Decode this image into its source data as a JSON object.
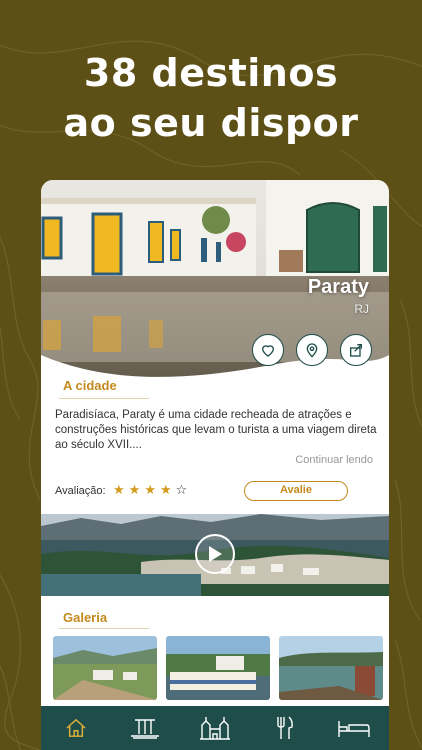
{
  "headline": {
    "line1": "38 destinos",
    "line2": "ao seu dispor"
  },
  "hero": {
    "city": "Paraty",
    "state": "RJ"
  },
  "actions": [
    "heart-icon",
    "location-pin-icon",
    "share-icon"
  ],
  "about": {
    "title": "A cidade",
    "description": "Paradisíaca, Paraty é uma cidade recheada de atrações e construções históricas que levam o turista a uma viagem direta ao século XVII....",
    "read_more": "Continuar lendo"
  },
  "rating": {
    "label": "Avaliação:",
    "stars": 4,
    "max": 5,
    "rate_button": "Avalie"
  },
  "gallery": {
    "title": "Galeria"
  },
  "tabbar": [
    "home-icon",
    "waterfall-icon",
    "church-icon",
    "restaurant-icon",
    "bed-icon"
  ],
  "colors": {
    "background": "#5d5016",
    "accent": "#c48a1d",
    "nav": "#1e4d4a"
  }
}
